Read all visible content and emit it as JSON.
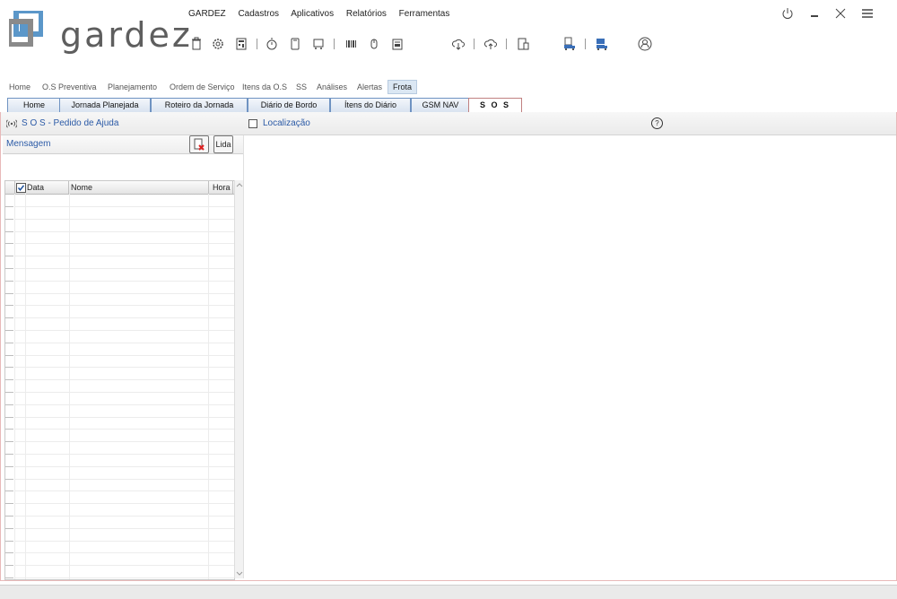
{
  "app": {
    "brand": "gardez",
    "accent": "#2b5aa6",
    "logo_colors": [
      "#5b97c9",
      "#8a8a8a"
    ]
  },
  "menu": [
    "GARDEZ",
    "Cadastros",
    "Aplicativos",
    "Relatórios",
    "Ferramentas"
  ],
  "toolbar_icons": [
    "trash-icon",
    "gear-icon",
    "calculator-icon",
    "stopwatch-icon",
    "phone-icon",
    "cart-icon",
    "barcode-icon",
    "mouse-icon",
    "folder-icon",
    "cloud-download-icon",
    "cloud-upload-icon",
    "devices-icon",
    "truck-report-icon",
    "truck-sync-icon",
    "user-circle-icon"
  ],
  "window_controls": [
    "power-icon",
    "minimize-icon",
    "close-icon",
    "hamburger-icon"
  ],
  "top_nav": [
    "Home",
    "O.S Preventiva",
    "Planejamento",
    "Ordem de Serviço",
    "Itens da O.S",
    "SS",
    "Análises",
    "Alertas",
    "Frota"
  ],
  "top_nav_active": "Frota",
  "tabs": [
    "Home",
    "Jornada Planejada",
    "Roteiro da Jornada",
    "Diário de Bordo",
    "Ítens do Diário",
    "GSM NAV",
    "S O S"
  ],
  "tabs_active": "S O S",
  "panel": {
    "title": "S O S - Pedido de Ajuda",
    "location_label": "Localização",
    "help": "?",
    "message_label": "Mensagem",
    "lida_label": "Lida"
  },
  "grid": {
    "columns": [
      "Data",
      "Nome",
      "Hora"
    ],
    "header_checkbox_checked": true,
    "rows": []
  }
}
